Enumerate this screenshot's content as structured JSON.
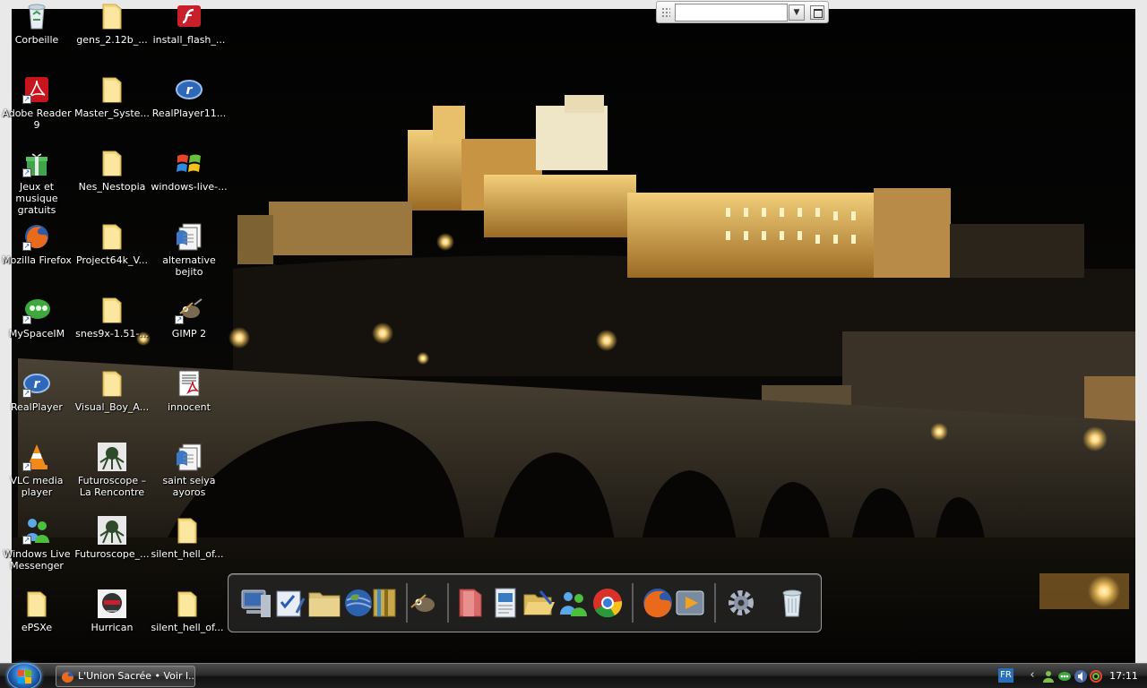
{
  "desktop": {
    "icons": [
      {
        "label": "Corbeille",
        "icon": "recycle-bin-icon"
      },
      {
        "label": "gens_2.12b_...",
        "icon": "folder-icon"
      },
      {
        "label": "install_flash_...",
        "icon": "flash-installer-icon"
      },
      {
        "label": "Adobe Reader 9",
        "icon": "adobe-reader-icon"
      },
      {
        "label": "Master_Syste...",
        "icon": "folder-icon"
      },
      {
        "label": "RealPlayer11...",
        "icon": "realplayer-icon"
      },
      {
        "label": "Jeux et musique gratuits",
        "icon": "gift-icon"
      },
      {
        "label": "Nes_Nestopia",
        "icon": "folder-icon"
      },
      {
        "label": "windows-live-...",
        "icon": "windows-flag-icon"
      },
      {
        "label": "Mozilla Firefox",
        "icon": "firefox-icon"
      },
      {
        "label": "Project64k_V...",
        "icon": "folder-icon"
      },
      {
        "label": "alternative bejito",
        "icon": "document-stack-icon"
      },
      {
        "label": "MySpaceIM",
        "icon": "myspaceim-icon"
      },
      {
        "label": "snes9x-1.51-...",
        "icon": "folder-icon"
      },
      {
        "label": "GIMP 2",
        "icon": "gimp-icon"
      },
      {
        "label": "RealPlayer",
        "icon": "realplayer-icon"
      },
      {
        "label": "Visual_Boy_A...",
        "icon": "folder-icon"
      },
      {
        "label": "innocent",
        "icon": "pdf-document-icon"
      },
      {
        "label": "VLC media player",
        "icon": "vlc-cone-icon"
      },
      {
        "label": "Futuroscope – La Rencontre",
        "icon": "futuroscope-icon"
      },
      {
        "label": "saint seiya ayoros",
        "icon": "document-stack-icon"
      },
      {
        "label": "Windows Live Messenger",
        "icon": "messenger-icon"
      },
      {
        "label": "Futuroscope_...",
        "icon": "futuroscope-icon"
      },
      {
        "label": "silent_hell_of...",
        "icon": "folder-icon"
      },
      {
        "label": "ePSXe",
        "icon": "folder-icon"
      },
      {
        "label": "Hurrican",
        "icon": "hurrican-icon"
      },
      {
        "label": "silent_hell_of...",
        "icon": "folder-icon"
      }
    ]
  },
  "floating_toolbar": {
    "search_value": ""
  },
  "dock": {
    "items": [
      "my-computer-icon",
      "checklist-icon",
      "folder-icon",
      "google-earth-icon",
      "archive-icon",
      "gimp-icon",
      "red-folder-icon",
      "document-icon",
      "open-folder-icon",
      "users-icon",
      "chrome-icon",
      "firefox-icon",
      "media-player-icon",
      "settings-gear-icon",
      "trash-icon"
    ]
  },
  "taskbar": {
    "task_label": "L'Union Sacrée • Voir l...",
    "language": "FR",
    "clock": "17:11"
  },
  "colors": {
    "taskbar": "#1c1c1c",
    "start_orb": "#2d74c8",
    "folder": "#f3d77a",
    "night_sky": "#050505",
    "castle_light": "#d9a850"
  }
}
